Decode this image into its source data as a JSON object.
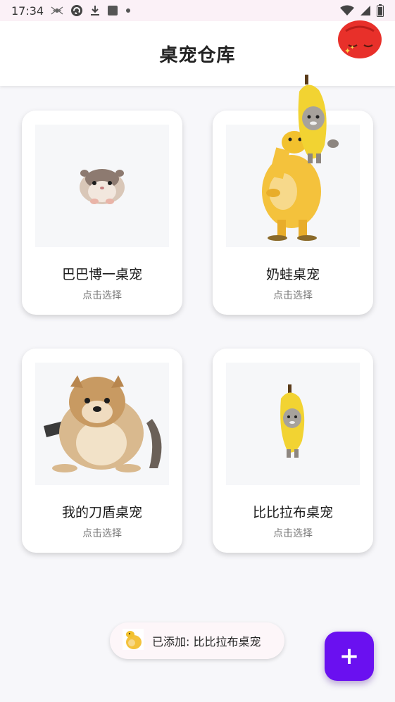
{
  "status_bar": {
    "time": "17:34",
    "icons": [
      "spider-icon",
      "sync-icon",
      "download-icon",
      "square-icon",
      "dot-icon",
      "wifi-icon",
      "signal-icon",
      "battery-icon"
    ]
  },
  "app_bar": {
    "title": "桌宠仓库"
  },
  "pets": [
    {
      "name": "巴巴博一桌宠",
      "hint": "点击选择",
      "icon": "hamster-icon"
    },
    {
      "name": "奶蛙桌宠",
      "hint": "点击选择",
      "icon": "yellow-frog-icon"
    },
    {
      "name": "我的刀盾桌宠",
      "hint": "点击选择",
      "icon": "shield-doge-icon"
    },
    {
      "name": "比比拉布桌宠",
      "hint": "点击选择",
      "icon": "banana-cat-icon"
    }
  ],
  "toast": {
    "text": "已添加: 比比拉布桌宠",
    "icon": "yellow-frog-icon"
  },
  "fab": {
    "label": "+"
  },
  "colors": {
    "accent": "#6a10f0",
    "background": "#f7f7fa",
    "status_bar": "#fbf1f7"
  }
}
